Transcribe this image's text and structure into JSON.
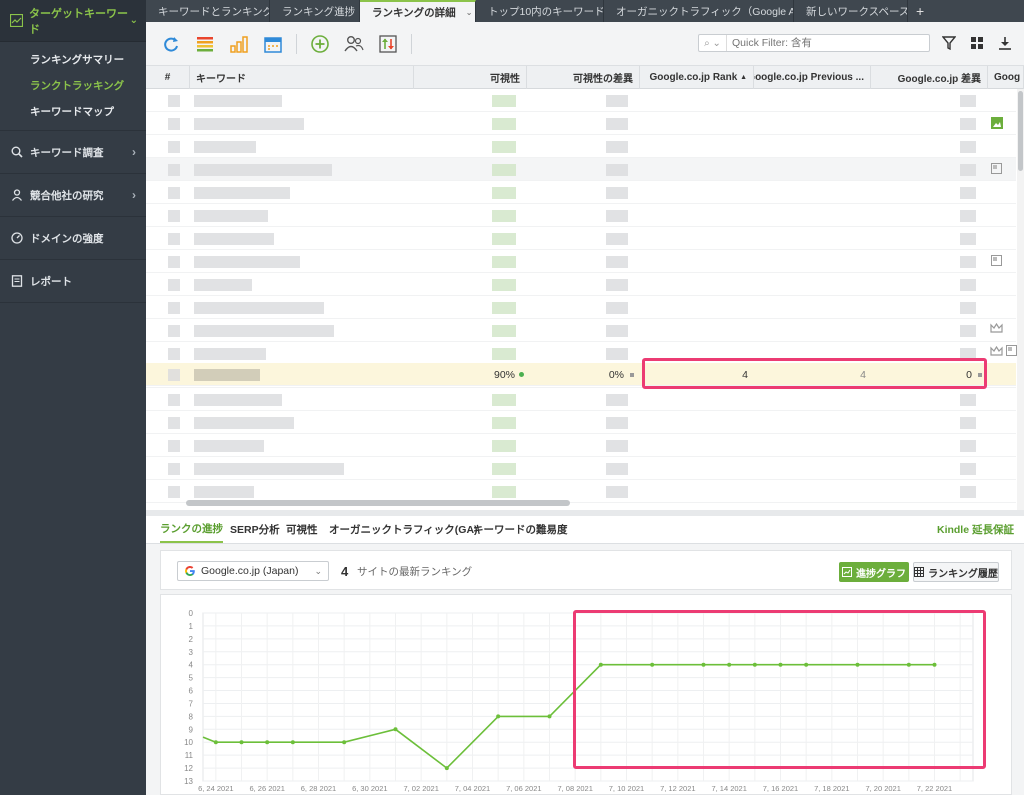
{
  "sidebar": {
    "header": {
      "label": "ターゲットキーワード",
      "icon": "chart-icon"
    },
    "subitems": [
      {
        "label": "ランキングサマリー"
      },
      {
        "label": "ランクトラッキング"
      },
      {
        "label": "キーワードマップ"
      }
    ],
    "items": [
      {
        "label": "キーワード調査",
        "icon": "search-icon"
      },
      {
        "label": "競合他社の研究",
        "icon": "user-icon"
      },
      {
        "label": "ドメインの強度",
        "icon": "gauge-icon"
      },
      {
        "label": "レポート",
        "icon": "report-icon"
      }
    ]
  },
  "tabs": [
    {
      "label": "キーワードとランキング"
    },
    {
      "label": "ランキング進捗"
    },
    {
      "label": "ランキングの詳細"
    },
    {
      "label": "トップ10内のキーワード"
    },
    {
      "label": "オーガニックトラフィック（Google A..."
    },
    {
      "label": "新しいワークスペース"
    }
  ],
  "toolbar": {
    "quick_filter_placeholder": "Quick Filter: 含有",
    "colors": {
      "accent": "#8bc34a",
      "blue": "#2f8ad8",
      "orange": "#f0a020",
      "green": "#6cae3c"
    }
  },
  "grid": {
    "headers": [
      "#",
      "キーワード",
      "可視性",
      "可視性の差異",
      "Google.co.jp Rank",
      "Google.co.jp Previous ...",
      "Google.co.jp 差異",
      "Goog"
    ],
    "highlight_row": {
      "visibility": "90%",
      "visibility_diff": "0%",
      "rank": "4",
      "previous": "4",
      "diff": "0"
    }
  },
  "bottom": {
    "tabs": [
      "ランクの進捗",
      "SERP分析",
      "可視性",
      "オーガニックトラフィック(GA)",
      "キーワードの難易度"
    ],
    "kindle_link": "Kindle 延長保証",
    "engine_select": "Google.co.jp (Japan)",
    "latest_rank": "4",
    "latest_rank_label": "サイトの最新ランキング",
    "btn_progress": "進捗グラフ",
    "btn_history": "ランキング履歴"
  },
  "chart_data": {
    "type": "line",
    "title": "",
    "xlabel": "",
    "ylabel": "",
    "ylim": [
      0,
      13
    ],
    "y_inverted": true,
    "yticks": [
      "0",
      "1",
      "2",
      "3",
      "4",
      "5",
      "6",
      "7",
      "8",
      "9",
      "10",
      "11",
      "12",
      "13"
    ],
    "xticks": [
      "6, 24 2021",
      "6, 26 2021",
      "6, 28 2021",
      "6, 30 2021",
      "7, 02 2021",
      "7, 04 2021",
      "7, 06 2021",
      "7, 08 2021",
      "7, 10 2021",
      "7, 12 2021",
      "7, 14 2021",
      "7, 16 2021",
      "7, 18 2021",
      "7, 20 2021",
      "7, 22 2021"
    ],
    "grid": true,
    "series_color": "#6cbf3a",
    "series": [
      {
        "points": [
          [
            "2021-06-24",
            10
          ],
          [
            "2021-06-25",
            10
          ],
          [
            "2021-06-26",
            10
          ],
          [
            "2021-06-27",
            10
          ],
          [
            "2021-06-29",
            10
          ],
          [
            "2021-07-01",
            9
          ],
          [
            "2021-07-03",
            12
          ],
          [
            "2021-07-05",
            8
          ],
          [
            "2021-07-07",
            8
          ],
          [
            "2021-07-09",
            4
          ],
          [
            "2021-07-11",
            4
          ],
          [
            "2021-07-13",
            4
          ],
          [
            "2021-07-14",
            4
          ],
          [
            "2021-07-15",
            4
          ],
          [
            "2021-07-16",
            4
          ],
          [
            "2021-07-17",
            4
          ],
          [
            "2021-07-19",
            4
          ],
          [
            "2021-07-21",
            4
          ],
          [
            "2021-07-22",
            4
          ]
        ]
      }
    ]
  }
}
